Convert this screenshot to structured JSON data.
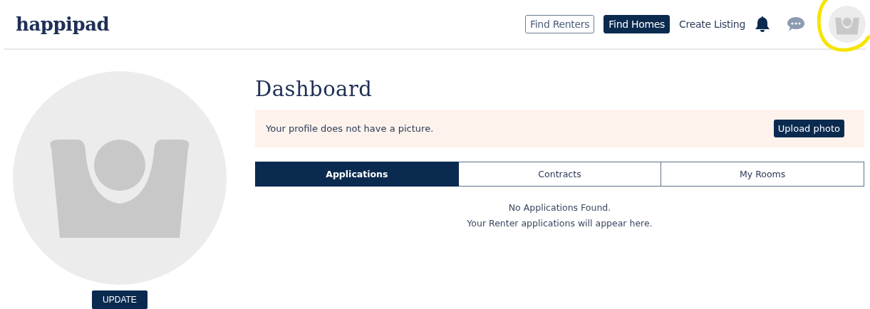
{
  "header": {
    "logo": "happipad",
    "nav": [
      {
        "kind": "outlined",
        "label": "Find Renters"
      },
      {
        "kind": "filled",
        "label": "Find Homes"
      },
      {
        "kind": "link",
        "label": "Create Listing"
      }
    ]
  },
  "sidebar": {
    "update_button": "UPDATE"
  },
  "dashboard": {
    "title": "Dashboard",
    "notice": {
      "text": "Your profile does not have a picture.",
      "button": "Upload photo"
    },
    "tabs": [
      {
        "label": "Applications",
        "selected": true
      },
      {
        "label": "Contracts",
        "selected": false
      },
      {
        "label": "My Rooms",
        "selected": false
      }
    ],
    "empty_state": [
      "No Applications Found.",
      "Your Renter applications will appear here."
    ]
  }
}
